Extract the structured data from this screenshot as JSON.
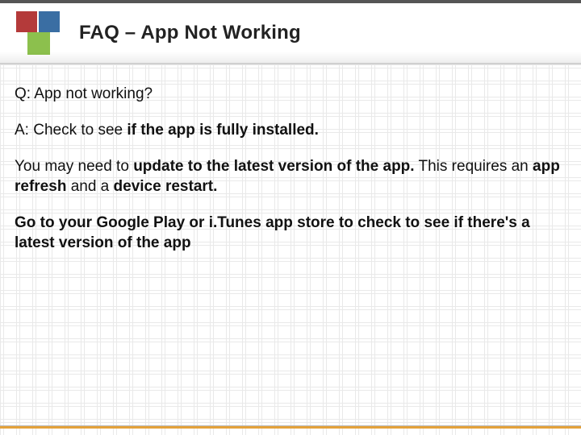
{
  "header": {
    "title": "FAQ – App Not Working"
  },
  "body": {
    "question": "Q: App not working?",
    "answer_prefix": "A: Check to see ",
    "answer_bold": "if the app is fully installed.",
    "p2_a": "You may need to ",
    "p2_b": "update to the latest version of the app.",
    "p2_c": " This requires an ",
    "p2_d": "app refresh",
    "p2_e": " and a ",
    "p2_f": "device restart.",
    "p3": "Go to your Google Play or i.Tunes app store to check to see if there's a latest version of the app"
  }
}
